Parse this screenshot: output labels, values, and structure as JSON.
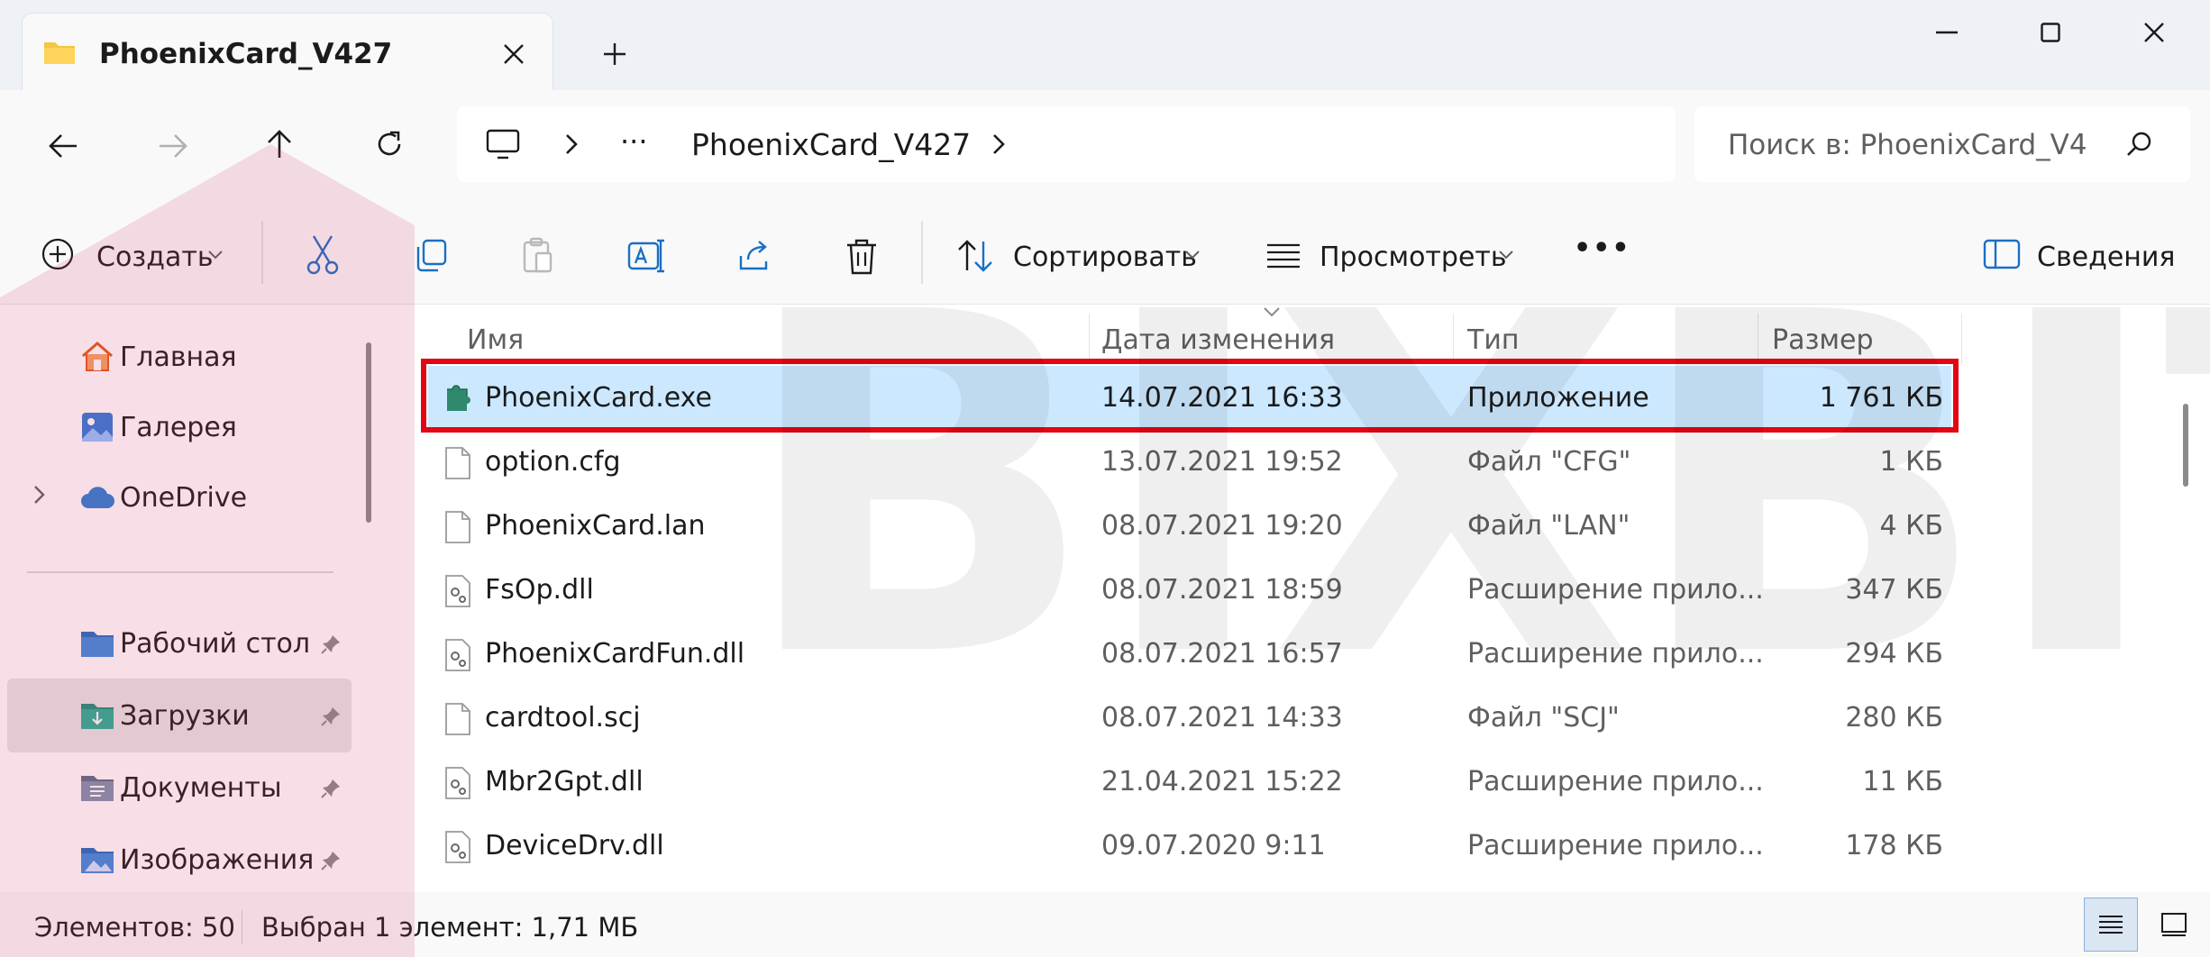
{
  "window": {
    "tab_title": "PhoenixCard_V427",
    "icons": {
      "folder": "folder-icon",
      "close": "close-icon",
      "new_tab": "plus-icon",
      "minimize": "minimize-icon",
      "maximize": "maximize-icon"
    }
  },
  "nav": {
    "breadcrumb_ellipsis": "···",
    "breadcrumb_folder": "PhoenixCard_V427",
    "search_placeholder": "Поиск в: PhoenixCard_V4"
  },
  "toolbar": {
    "create_label": "Создать",
    "sort_label": "Сортировать",
    "view_label": "Просмотреть",
    "more_label": "•••",
    "details_label": "Сведения"
  },
  "sidebar": {
    "items": [
      {
        "label": "Главная",
        "icon": "home-icon",
        "pinned": false
      },
      {
        "label": "Галерея",
        "icon": "gallery-icon",
        "pinned": false
      },
      {
        "label": "OneDrive",
        "icon": "cloud-icon",
        "pinned": false
      },
      {
        "label": "Рабочий стол",
        "icon": "desktop-folder-icon",
        "pinned": true
      },
      {
        "label": "Загрузки",
        "icon": "downloads-folder-icon",
        "pinned": true,
        "selected": true
      },
      {
        "label": "Документы",
        "icon": "documents-folder-icon",
        "pinned": true
      },
      {
        "label": "Изображения",
        "icon": "pictures-folder-icon",
        "pinned": true
      }
    ]
  },
  "filelist": {
    "columns": [
      "Имя",
      "Дата изменения",
      "Тип",
      "Размер"
    ],
    "rows": [
      {
        "name": "PhoenixCard.exe",
        "date": "14.07.2021 16:33",
        "type": "Приложение",
        "size": "1 761 КБ",
        "selected": true,
        "icon": "app-icon"
      },
      {
        "name": "option.cfg",
        "date": "13.07.2021 19:52",
        "type": "Файл \"CFG\"",
        "size": "1 КБ",
        "icon": "file-icon"
      },
      {
        "name": "PhoenixCard.lan",
        "date": "08.07.2021 19:20",
        "type": "Файл \"LAN\"",
        "size": "4 КБ",
        "icon": "file-icon"
      },
      {
        "name": "FsOp.dll",
        "date": "08.07.2021 18:59",
        "type": "Расширение прило...",
        "size": "347 КБ",
        "icon": "dll-icon"
      },
      {
        "name": "PhoenixCardFun.dll",
        "date": "08.07.2021 16:57",
        "type": "Расширение прило...",
        "size": "294 КБ",
        "icon": "dll-icon"
      },
      {
        "name": "cardtool.scj",
        "date": "08.07.2021 14:33",
        "type": "Файл \"SCJ\"",
        "size": "280 КБ",
        "icon": "file-icon"
      },
      {
        "name": "Mbr2Gpt.dll",
        "date": "21.04.2021 15:22",
        "type": "Расширение прило...",
        "size": "11 КБ",
        "icon": "dll-icon"
      },
      {
        "name": "DeviceDrv.dll",
        "date": "09.07.2020 9:11",
        "type": "Расширение прило...",
        "size": "178 КБ",
        "icon": "dll-icon"
      }
    ]
  },
  "status": {
    "count": "Элементов: 50",
    "selection": "Выбран 1 элемент: 1,71 МБ"
  },
  "watermark": {
    "text": "BIXBIT"
  },
  "colors": {
    "selection": "#cce8ff",
    "highlight_frame": "#e30613",
    "accent": "#0067c0"
  }
}
